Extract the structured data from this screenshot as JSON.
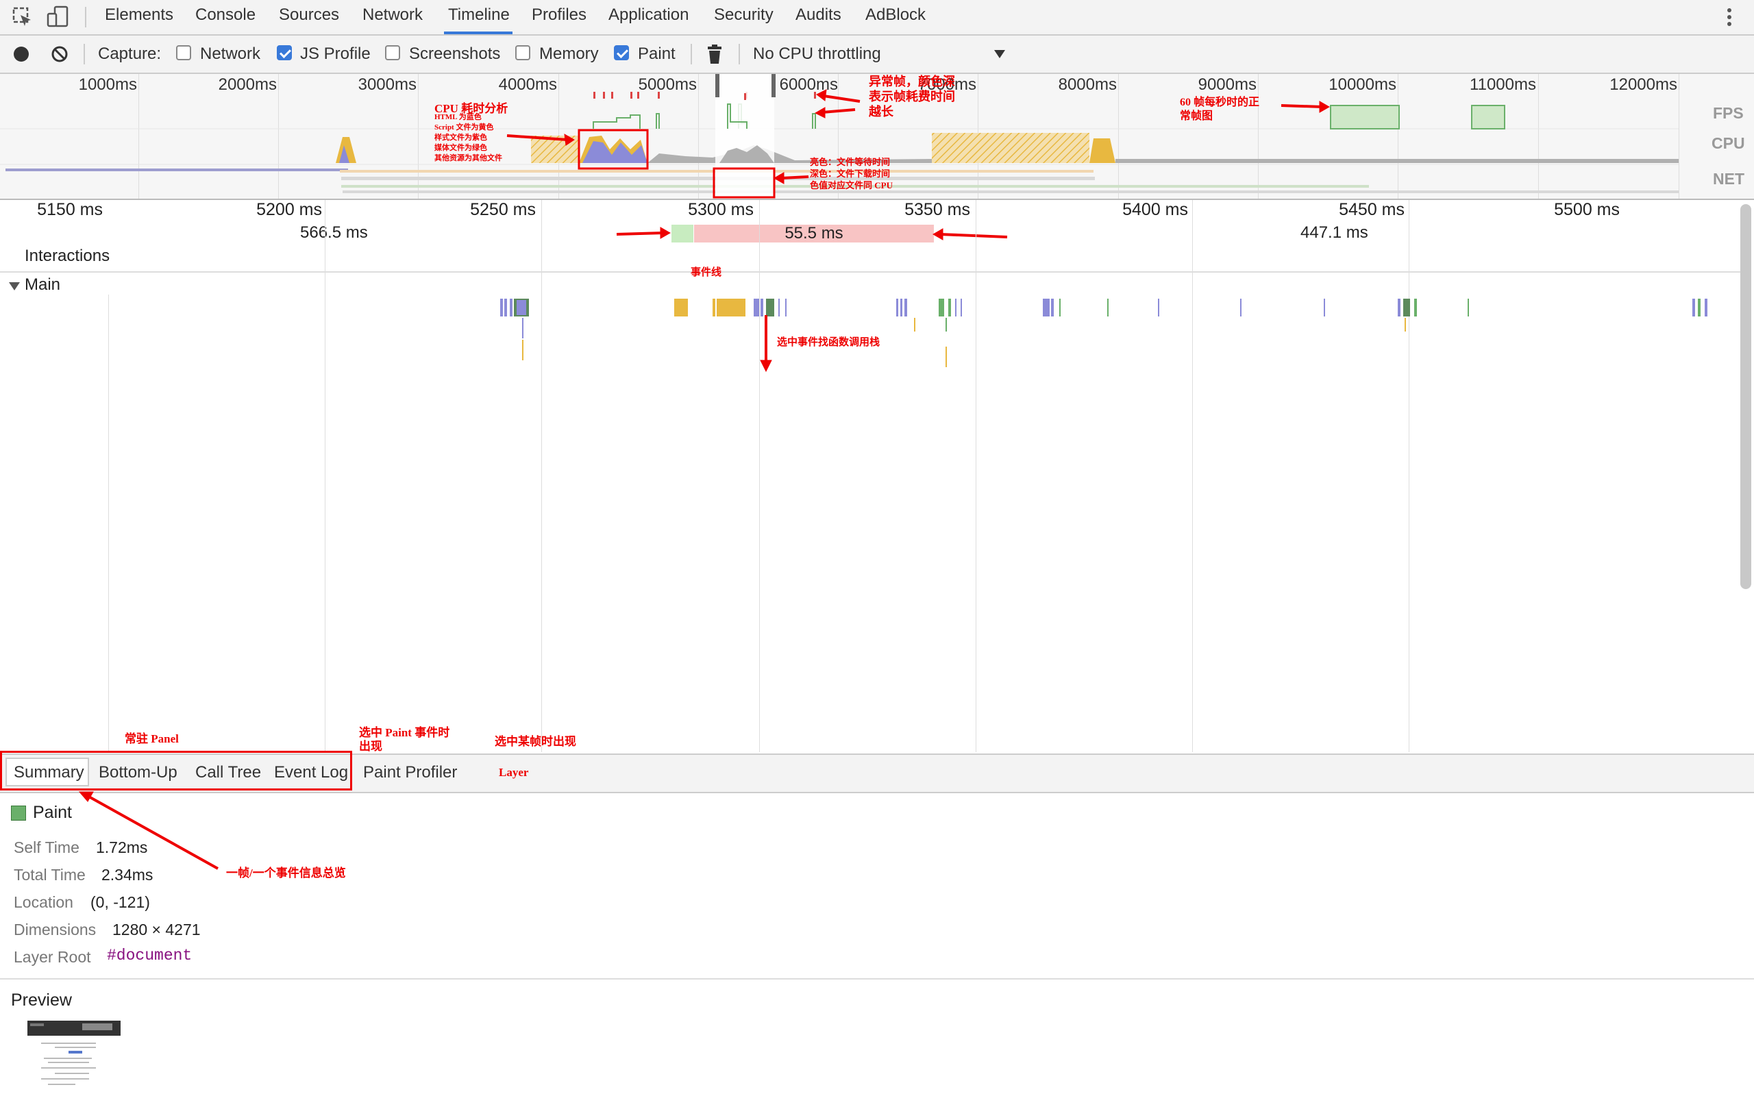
{
  "tabs": [
    "Elements",
    "Console",
    "Sources",
    "Network",
    "Timeline",
    "Profiles",
    "Application",
    "Security",
    "Audits",
    "AdBlock"
  ],
  "active_tab": "Timeline",
  "toolbar": {
    "capture_label": "Capture:",
    "network_label": "Network",
    "js_profile_label": "JS Profile",
    "screenshots_label": "Screenshots",
    "memory_label": "Memory",
    "paint_label": "Paint",
    "throttling_value": "No CPU throttling",
    "network_checked": false,
    "js_profile_checked": true,
    "screenshots_checked": false,
    "memory_checked": false,
    "paint_checked": true
  },
  "overview": {
    "ticks": [
      "1000ms",
      "2000ms",
      "3000ms",
      "4000ms",
      "5000ms",
      "6000ms",
      "7000ms",
      "8000ms",
      "9000ms",
      "10000ms",
      "11000ms",
      "12000ms"
    ],
    "row_labels": {
      "fps": "FPS",
      "cpu": "CPU",
      "net": "NET"
    }
  },
  "ruler": {
    "ticks": [
      "5150 ms",
      "5200 ms",
      "5250 ms",
      "5300 ms",
      "5350 ms",
      "5400 ms",
      "5450 ms",
      "5500 ms"
    ],
    "frames": [
      "566.5 ms",
      "55.5 ms",
      "447.1 ms"
    ]
  },
  "tracks": {
    "interactions": "Interactions",
    "main": "Main"
  },
  "bottom_tabs": [
    "Summary",
    "Bottom-Up",
    "Call Tree",
    "Event Log",
    "Paint Profiler"
  ],
  "summary": {
    "event_name": "Paint",
    "event_color": "#6ab06a",
    "rows": [
      {
        "key": "Self Time",
        "value": "1.72ms"
      },
      {
        "key": "Total Time",
        "value": "2.34ms"
      },
      {
        "key": "Location",
        "value": "(0, -121)"
      },
      {
        "key": "Dimensions",
        "value": "1280 × 4271"
      },
      {
        "key": "Layer Root",
        "value": "#document"
      }
    ],
    "preview_label": "Preview"
  },
  "annotations": {
    "abnormal_frame": "异常帧，颜色深\n表示帧耗费时间\n越长",
    "fps60": "60 帧每秒时的正\n常帧图",
    "cpu_analysis": "CPU 耗时分析",
    "cpu_legend": "HTML 为蓝色\nScript 文件为黄色\n样式文件为紫色\n媒体文件为绿色\n其他资源为其他文件",
    "net_legend": "亮色：文件等待时间\n深色：文件下载时间\n色值对应文件同 CPU",
    "event_line": "事件线",
    "call_stack": "选中事件找函数调用栈",
    "resident_panel": "常驻 Panel",
    "paint_selected": "选中 Paint 事件时\n出现",
    "frame_selected": "选中某帧时出现",
    "layer": "Layer",
    "summary_note": "一帧/一个事件信息总览"
  },
  "colors": {
    "accent": "#3879d9",
    "annotation": "#e00000",
    "script": "#e8b840",
    "html": "#8b8bd8",
    "paint": "#6ab06a",
    "frame_long": "#f8c4c4",
    "frame_ok": "#c8ecc0"
  }
}
